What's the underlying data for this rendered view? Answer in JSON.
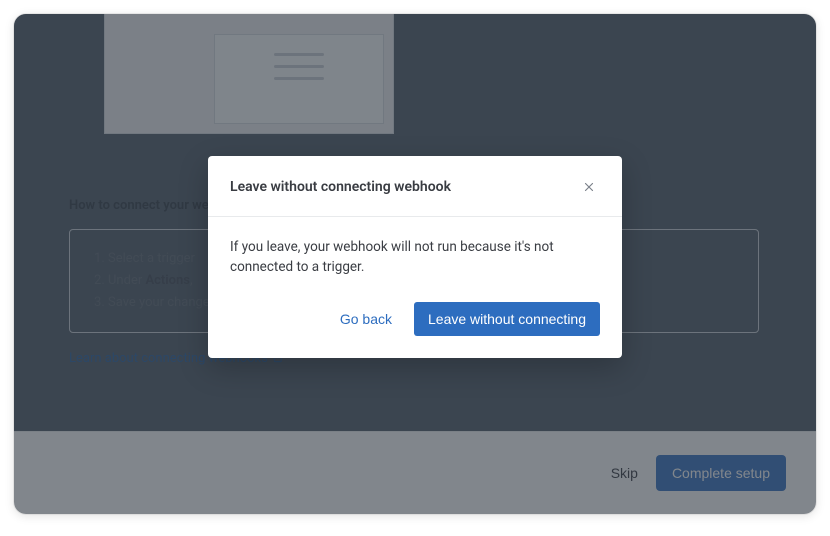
{
  "background": {
    "section_title": "How to connect your webhook",
    "steps": [
      "Select a trigger",
      "Under Actions,",
      "Save your changes"
    ],
    "learn_link": "Learn about connecting webhooks"
  },
  "footer": {
    "skip_label": "Skip",
    "complete_label": "Complete setup"
  },
  "modal": {
    "title": "Leave without connecting webhook",
    "body": "If you leave, your webhook will not run because it's not connected to a trigger.",
    "go_back": "Go back",
    "leave": "Leave without connecting"
  }
}
